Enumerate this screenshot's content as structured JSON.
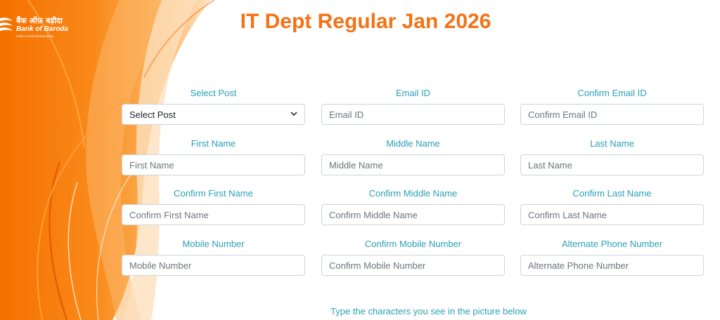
{
  "brand": {
    "hindi_name": "बैंक ऑफ़ बड़ौदा",
    "english_name": "Bank of Baroda",
    "tagline": "India's International Bank",
    "accent_color": "#f47216",
    "label_color": "#2ba0b5"
  },
  "page": {
    "title": "IT Dept Regular Jan 2026"
  },
  "form": {
    "select_post": {
      "label": "Select Post",
      "value": "Select Post"
    },
    "email": {
      "label": "Email ID",
      "placeholder": "Email ID"
    },
    "confirm_email": {
      "label": "Confirm Email ID",
      "placeholder": "Confirm Email ID"
    },
    "first_name": {
      "label": "First Name",
      "placeholder": "First Name"
    },
    "middle_name": {
      "label": "Middle Name",
      "placeholder": "Middle Name"
    },
    "last_name": {
      "label": "Last Name",
      "placeholder": "Last Name"
    },
    "confirm_first_name": {
      "label": "Confirm First Name",
      "placeholder": "Confirm First Name"
    },
    "confirm_middle_name": {
      "label": "Confirm Middle Name",
      "placeholder": "Confirm Middle Name"
    },
    "confirm_last_name": {
      "label": "Confirm Last Name",
      "placeholder": "Confirm Last Name"
    },
    "mobile": {
      "label": "Mobile Number",
      "placeholder": "Mobile Number"
    },
    "confirm_mobile": {
      "label": "Confirm Mobile Number",
      "placeholder": "Confirm Mobile Number"
    },
    "alternate_phone": {
      "label": "Alternate Phone Number",
      "placeholder": "Alternate Phone Number"
    }
  },
  "captcha": {
    "instruction": "Type the characters you see in the picture below"
  }
}
